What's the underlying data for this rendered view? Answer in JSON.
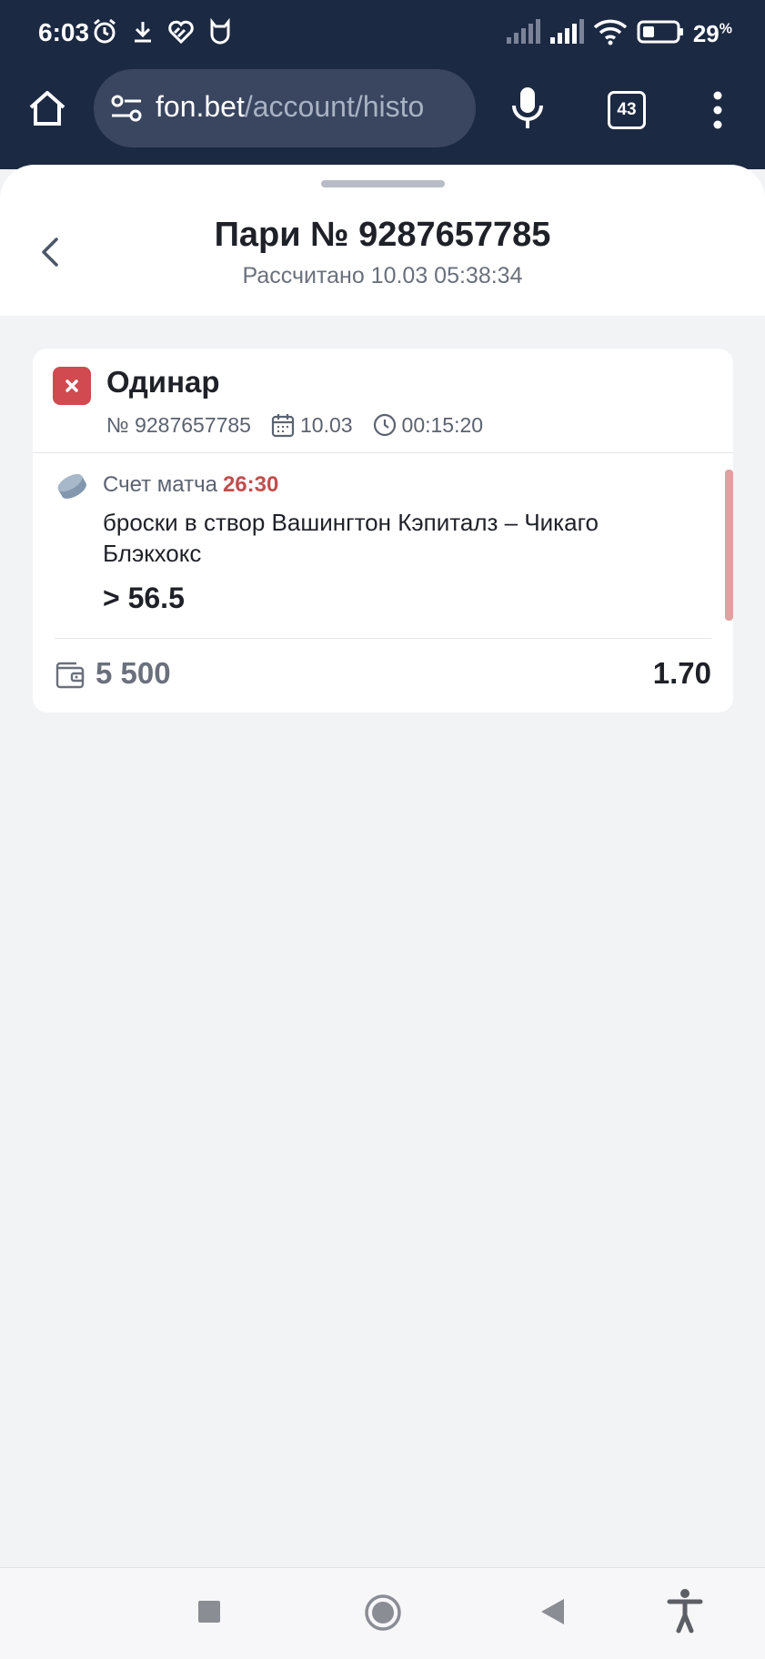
{
  "status_bar": {
    "time": "6:03",
    "battery": "29",
    "battery_unit": "%"
  },
  "browser": {
    "url_domain": "fon.bet",
    "url_path": "/account/histo",
    "tab_count": "43"
  },
  "sheet": {
    "title": "Пари № 9287657785",
    "subtitle": "Рассчитано 10.03 05:38:34"
  },
  "bet": {
    "type": "Одинар",
    "number": "№ 9287657785",
    "date": "10.03",
    "time": "00:15:20",
    "market_label": "Счет матча",
    "score": "26:30",
    "event": "броски в створ Вашингтон Кэпиталз – Чикаго Блэкхокс",
    "outcome": "> 56.5",
    "stake": "5 500",
    "odds": "1.70",
    "status": "lost"
  },
  "colors": {
    "chrome_bg": "#1c2942",
    "loss_red": "#d04a4f",
    "score_red": "#c24d4d",
    "page_bg": "#f2f3f5"
  },
  "icons": {
    "status_left": [
      "alarm-icon",
      "download-icon",
      "health-icon",
      "mi-fit-icon"
    ],
    "status_right": [
      "cell-signal-icon",
      "cell-signal-icon",
      "wifi-icon",
      "battery-icon"
    ],
    "sport": "hockey-puck-icon",
    "stake": "wallet-icon",
    "nav": [
      "recents-square-icon",
      "home-circle-icon",
      "back-triangle-icon",
      "accessibility-icon"
    ]
  }
}
